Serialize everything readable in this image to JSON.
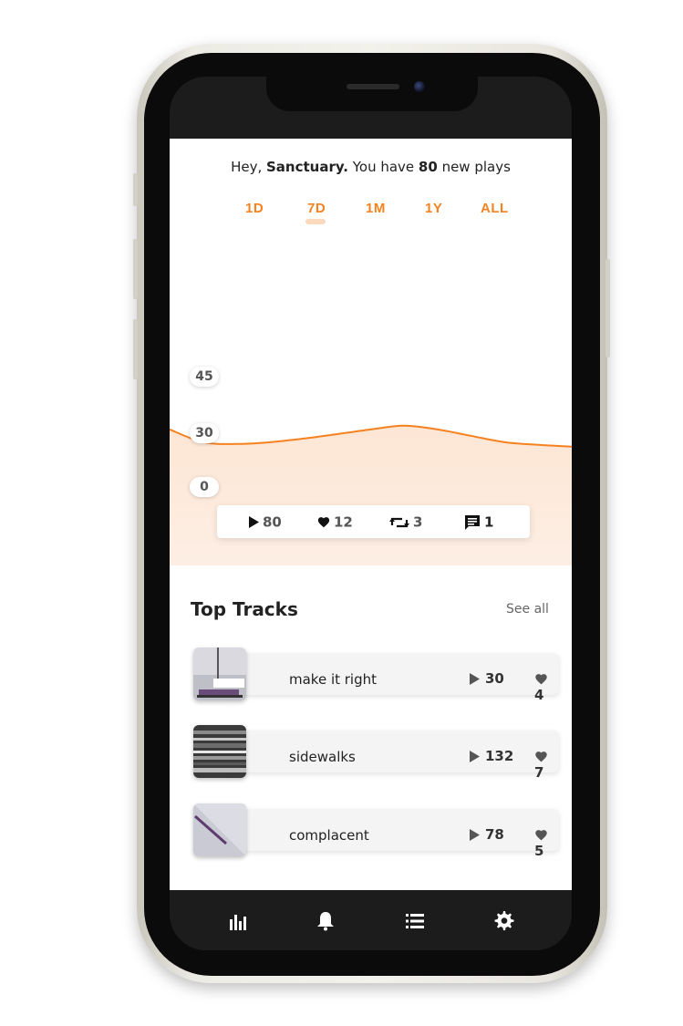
{
  "greeting": {
    "prefix": "Hey, ",
    "name": "Sanctuary.",
    "middle": " You have ",
    "count": "80",
    "suffix": " new plays"
  },
  "periods": {
    "items": [
      "1D",
      "7D",
      "1M",
      "1Y",
      "ALL"
    ],
    "selected": "7D"
  },
  "chart": {
    "y_labels": [
      "45",
      "30",
      "0"
    ]
  },
  "chart_data": {
    "type": "area",
    "title": "",
    "xlabel": "",
    "ylabel": "",
    "x": [
      0,
      1,
      2,
      3,
      4,
      5,
      6,
      7,
      8,
      9,
      10,
      11,
      12
    ],
    "series": [
      {
        "values": [
          31,
          25,
          24,
          25,
          27,
          29.5,
          31,
          32,
          31,
          28.5,
          25,
          23.5,
          22.5
        ]
      }
    ],
    "y_ticks": [
      0,
      30,
      45
    ],
    "grid": false,
    "colors": {
      "line": "#f58220",
      "fill": "#fde6d4"
    }
  },
  "stats": {
    "plays": "80",
    "likes": "12",
    "reposts": "3",
    "comments": "1"
  },
  "top_tracks": {
    "title": "Top Tracks",
    "see_all": "See all",
    "items": [
      {
        "title": "make it right",
        "plays": "30",
        "likes": "4"
      },
      {
        "title": "sidewalks",
        "plays": "132",
        "likes": "7"
      },
      {
        "title": "complacent",
        "plays": "78",
        "likes": "5"
      }
    ]
  },
  "tabbar": {
    "icons": [
      "stats-icon",
      "bell-icon",
      "list-icon",
      "gear-icon"
    ]
  },
  "colors": {
    "accent": "#f58220",
    "chart_fill": "#fde6d4",
    "tabbar_bg": "#1c1c1c"
  }
}
